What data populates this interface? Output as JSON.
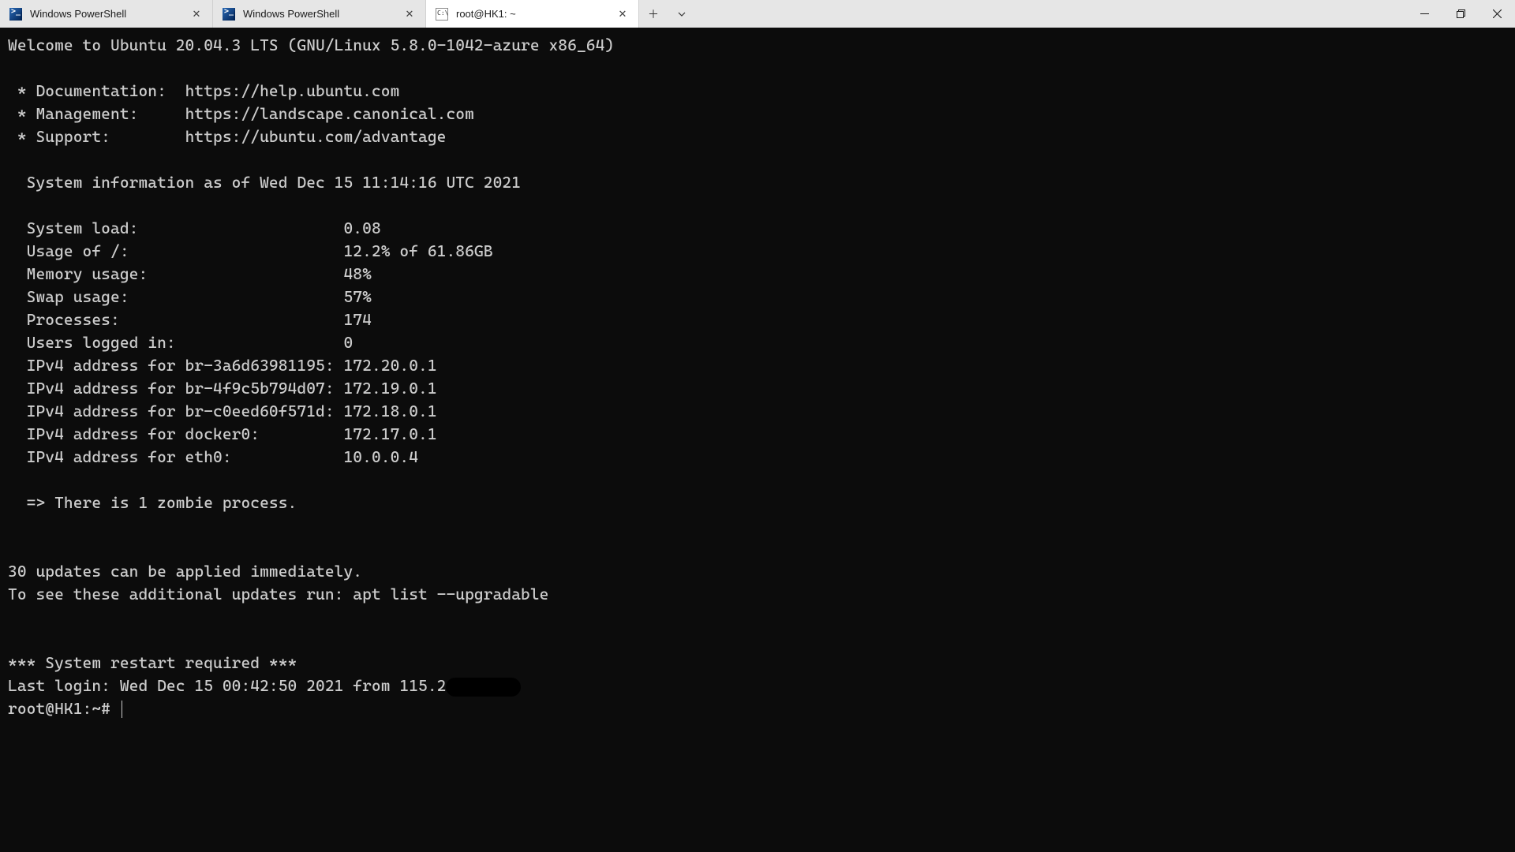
{
  "tabs": [
    {
      "title": "Windows PowerShell",
      "icon": "ps"
    },
    {
      "title": "Windows PowerShell",
      "icon": "ps"
    },
    {
      "title": "root@HK1: ~",
      "icon": "ssh"
    }
  ],
  "terminal": {
    "welcome": "Welcome to Ubuntu 20.04.3 LTS (GNU/Linux 5.8.0-1042-azure x86_64)",
    "links": {
      "doc_label": " * Documentation:  ",
      "doc_url": "https://help.ubuntu.com",
      "mgmt_label": " * Management:     ",
      "mgmt_url": "https://landscape.canonical.com",
      "sup_label": " * Support:        ",
      "sup_url": "https://ubuntu.com/advantage"
    },
    "sysinfo_header": "  System information as of Wed Dec 15 11:14:16 UTC 2021",
    "sys": {
      "load_l": "  System load:                      ",
      "load_v": "0.08",
      "usage_l": "  Usage of /:                       ",
      "usage_v": "12.2% of 61.86GB",
      "mem_l": "  Memory usage:                     ",
      "mem_v": "48%",
      "swap_l": "  Swap usage:                       ",
      "swap_v": "57%",
      "proc_l": "  Processes:                        ",
      "proc_v": "174",
      "users_l": "  Users logged in:                  ",
      "users_v": "0",
      "ip1_l": "  IPv4 address for br-3a6d63981195: ",
      "ip1_v": "172.20.0.1",
      "ip2_l": "  IPv4 address for br-4f9c5b794d07: ",
      "ip2_v": "172.19.0.1",
      "ip3_l": "  IPv4 address for br-c0eed60f571d: ",
      "ip3_v": "172.18.0.1",
      "ip4_l": "  IPv4 address for docker0:         ",
      "ip4_v": "172.17.0.1",
      "ip5_l": "  IPv4 address for eth0:            ",
      "ip5_v": "10.0.0.4"
    },
    "zombie": "  => There is 1 zombie process.",
    "updates1": "30 updates can be applied immediately.",
    "updates2": "To see these additional updates run: apt list --upgradable",
    "restart": "*** System restart required ***",
    "lastlogin_prefix": "Last login: Wed Dec 15 00:42:50 2021 from 115.2",
    "prompt": "root@HK1:~# "
  }
}
